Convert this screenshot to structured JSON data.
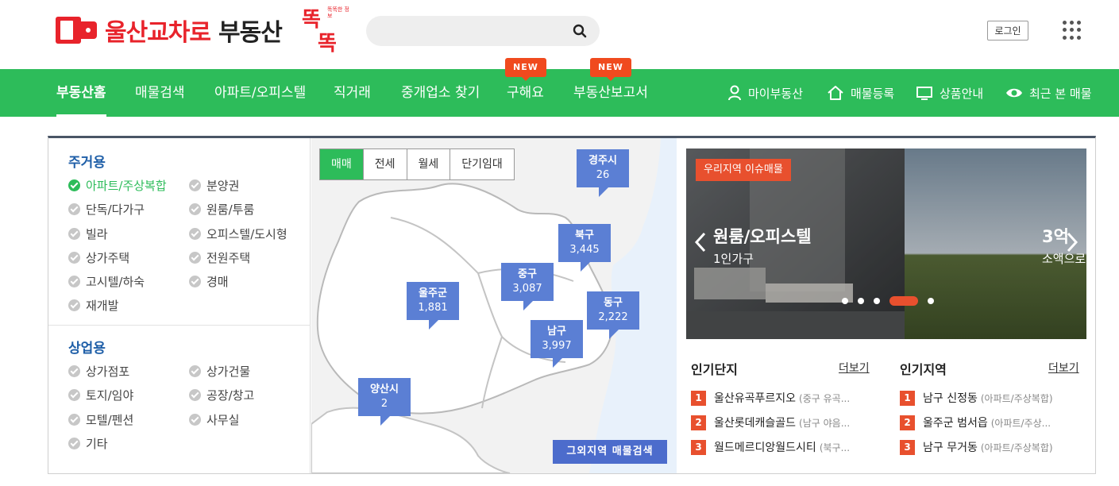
{
  "header": {
    "logo_red": "울산교차로",
    "logo_black": "부동산",
    "logo_ttok": "똑",
    "logo_tiny": "똑똑한 정보",
    "search_placeholder": "",
    "login": "로그인"
  },
  "nav": {
    "items": [
      "부동산홈",
      "매물검색",
      "아파트/오피스텔",
      "직거래",
      "중개업소 찾기",
      "구해요",
      "부동산보고서"
    ],
    "new_badge": "NEW",
    "utils": [
      "마이부동산",
      "매물등록",
      "상품안내",
      "최근 본 매물"
    ]
  },
  "categories": {
    "residential_title": "주거용",
    "residential": [
      "아파트/주상복합",
      "분양권",
      "단독/다가구",
      "원룸/투룸",
      "빌라",
      "오피스텔/도시형",
      "상가주택",
      "전원주택",
      "고시텔/하숙",
      "경매",
      "재개발"
    ],
    "commercial_title": "상업용",
    "commercial": [
      "상가점포",
      "상가건물",
      "토지/임야",
      "공장/창고",
      "모텔/펜션",
      "사무실",
      "기타"
    ]
  },
  "map": {
    "tabs": [
      "매매",
      "전세",
      "월세",
      "단기임대"
    ],
    "pins": [
      {
        "name": "경주시",
        "count": "26"
      },
      {
        "name": "북구",
        "count": "3,445"
      },
      {
        "name": "중구",
        "count": "3,087"
      },
      {
        "name": "울주군",
        "count": "1,881"
      },
      {
        "name": "동구",
        "count": "2,222"
      },
      {
        "name": "남구",
        "count": "3,997"
      },
      {
        "name": "양산시",
        "count": "2"
      }
    ],
    "other_button": "그외지역 매물검색"
  },
  "banner": {
    "tag": "우리지역 이슈매물",
    "title": "원룸/오피스텔",
    "subtitle": "1인가구",
    "title2": "3억",
    "subtitle2": "소액으로"
  },
  "popular_complex": {
    "title": "인기단지",
    "more": "더보기",
    "items": [
      {
        "rank": "1",
        "name": "울산유곡푸르지오",
        "sub": "(중구 유곡..."
      },
      {
        "rank": "2",
        "name": "울산롯데캐슬골드",
        "sub": "(남구 야음..."
      },
      {
        "rank": "3",
        "name": "월드메르디앙월드시티",
        "sub": "(북구..."
      }
    ]
  },
  "popular_region": {
    "title": "인기지역",
    "more": "더보기",
    "items": [
      {
        "rank": "1",
        "name": "남구 신정동",
        "sub": "(아파트/주상복합)"
      },
      {
        "rank": "2",
        "name": "울주군 범서읍",
        "sub": "(아파트/주상..."
      },
      {
        "rank": "3",
        "name": "남구 무거동",
        "sub": "(아파트/주상복합)"
      }
    ]
  },
  "colors": {
    "brand_red": "#e8232b",
    "nav_green": "#2dbc5a",
    "pin_blue": "#5b7fd4",
    "accent_orange": "#e8502e",
    "category_blue": "#1f5fa8"
  }
}
